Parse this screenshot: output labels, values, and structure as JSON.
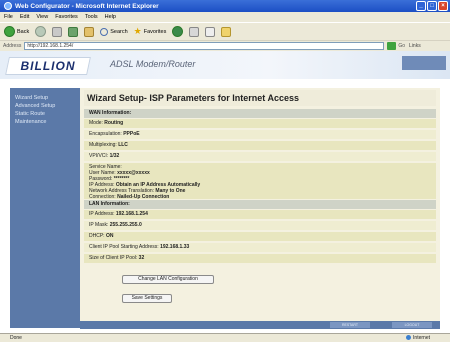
{
  "window": {
    "title": "Web Configurator - Microsoft Internet Explorer"
  },
  "menu": [
    "File",
    "Edit",
    "View",
    "Favorites",
    "Tools",
    "Help"
  ],
  "toolbar": {
    "back": "Back",
    "search": "Search",
    "favorites": "Favorites"
  },
  "address": {
    "label": "Address",
    "value": "http://192.168.1.254/",
    "go": "Go",
    "links": "Links"
  },
  "brand": {
    "logo": "BILLION",
    "product": "ADSL Modem/Router"
  },
  "sidebar": {
    "items": [
      "Wizard Setup",
      "Advanced Setup",
      "Static Route",
      "Maintenance"
    ]
  },
  "page": {
    "title": "Wizard Setup- ISP Parameters for Internet Access",
    "wan_header": "WAN Information:",
    "mode_label": "Mode:",
    "mode_value": "Routing",
    "encap_label": "Encapsulation:",
    "encap_value": "PPPoE",
    "mux_label": "Multiplexing:",
    "mux_value": "LLC",
    "vpi_label": "VPI/VCI:",
    "vpi_value": "1/32",
    "service_label": "Service Name:",
    "user_label": "User Name:",
    "user_value": "xxxxx@xxxxx",
    "pass_label": "Password:",
    "pass_value": "********",
    "ip_label": "IP Address:",
    "ip_value": "Obtain an IP Address Automatically",
    "nat_label": "Network Address Translation:",
    "nat_value": "Many to One",
    "conn_label": "Connection:",
    "conn_value": "Nailed-Up Connection",
    "lan_header": "LAN Information:",
    "lanip_label": "IP Address:",
    "lanip_value": "192.168.1.254",
    "mask_label": "IP Mask:",
    "mask_value": "255.255.255.0",
    "dhcp_label": "DHCP:",
    "dhcp_value": "ON",
    "pool_label": "Client IP Pool Starting Address:",
    "pool_value": "192.168.1.33",
    "poolsize_label": "Size of Client IP Pool:",
    "poolsize_value": "32",
    "change_lan_button": "Change LAN Configuration",
    "save_button": "Save Settings"
  },
  "footer": {
    "restart": "RESTART",
    "logout": "LOGOUT"
  },
  "status": {
    "left": "Done",
    "zone": "Internet"
  }
}
